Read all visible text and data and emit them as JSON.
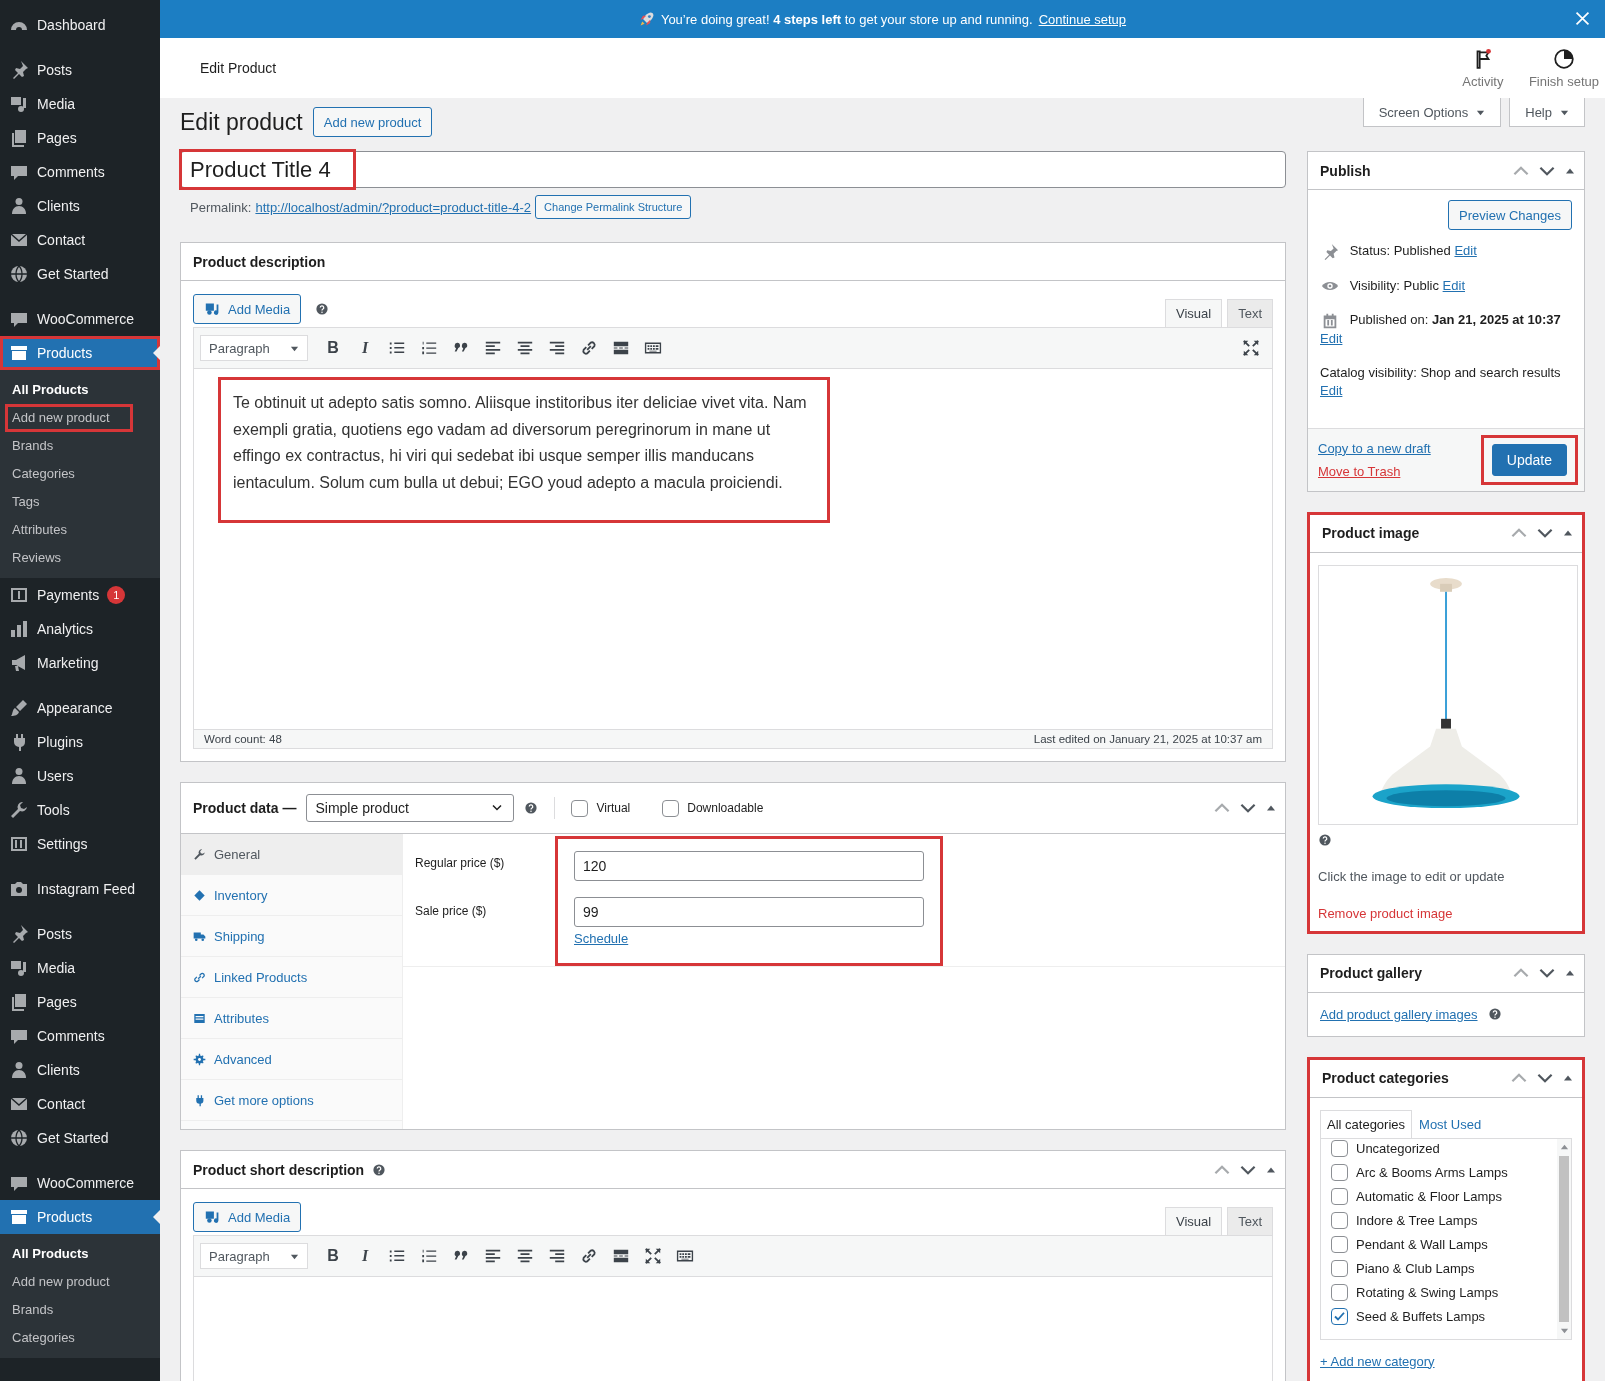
{
  "notice": {
    "text": "You’re doing great! **4 steps left** to get your store up and running.",
    "link": "Continue setup"
  },
  "sidebar": {
    "groups": [
      {
        "items": [
          {
            "label": "Dashboard",
            "selected": false,
            "highlighted": false
          }
        ]
      },
      {
        "items": [
          {
            "label": "Posts",
            "selected": false,
            "highlighted": false
          },
          {
            "label": "Media",
            "selected": false,
            "highlighted": false
          },
          {
            "label": "Pages",
            "selected": false,
            "highlighted": false
          },
          {
            "label": "Comments",
            "selected": false,
            "highlighted": false
          },
          {
            "label": "Clients",
            "selected": false,
            "highlighted": false
          },
          {
            "label": "Contact",
            "selected": false,
            "highlighted": false
          },
          {
            "label": "Get Started",
            "selected": false,
            "highlighted": false
          }
        ]
      },
      {
        "items": [
          {
            "label": "WooCommerce",
            "selected": false,
            "highlighted": false
          },
          {
            "label": "Products",
            "selected": true,
            "highlighted": true,
            "children": [
              {
                "label": "All Products",
                "selected": true,
                "highlighted": false
              },
              {
                "label": "Add new product",
                "selected": false,
                "highlighted": true
              },
              {
                "label": "Brands",
                "selected": false,
                "highlighted": false
              },
              {
                "label": "Categories",
                "selected": false,
                "highlighted": false
              },
              {
                "label": "Tags",
                "selected": false,
                "highlighted": false
              },
              {
                "label": "Attributes",
                "selected": false,
                "highlighted": false
              },
              {
                "label": "Reviews",
                "selected": false,
                "highlighted": false
              }
            ]
          },
          {
            "label": "Payments",
            "selected": false,
            "highlighted": false,
            "badge": "1"
          },
          {
            "label": "Analytics",
            "selected": false,
            "highlighted": false
          },
          {
            "label": "Marketing",
            "selected": false,
            "highlighted": false
          }
        ]
      },
      {
        "items": [
          {
            "label": "Appearance",
            "selected": false,
            "highlighted": false
          },
          {
            "label": "Plugins",
            "selected": false,
            "highlighted": false
          },
          {
            "label": "Users",
            "selected": false,
            "highlighted": false
          },
          {
            "label": "Tools",
            "selected": false,
            "highlighted": false
          },
          {
            "label": "Settings",
            "selected": false,
            "highlighted": false
          }
        ]
      },
      {
        "items": [
          {
            "label": "Instagram Feed",
            "selected": false,
            "highlighted": false
          }
        ]
      },
      {
        "items": [
          {
            "label": "Posts",
            "selected": false,
            "highlighted": false
          },
          {
            "label": "Media",
            "selected": false,
            "highlighted": false
          },
          {
            "label": "Pages",
            "selected": false,
            "highlighted": false
          },
          {
            "label": "Comments",
            "selected": false,
            "highlighted": false
          },
          {
            "label": "Clients",
            "selected": false,
            "highlighted": false
          },
          {
            "label": "Contact",
            "selected": false,
            "highlighted": false
          },
          {
            "label": "Get Started",
            "selected": false,
            "highlighted": false
          }
        ]
      },
      {
        "items": [
          {
            "label": "WooCommerce",
            "selected": false,
            "highlighted": false
          },
          {
            "label": "Products",
            "selected": true,
            "highlighted": false,
            "children": [
              {
                "label": "All Products",
                "selected": true,
                "highlighted": false
              },
              {
                "label": "Add new product",
                "selected": false,
                "highlighted": false
              },
              {
                "label": "Brands",
                "selected": false,
                "highlighted": false
              },
              {
                "label": "Categories",
                "selected": false,
                "highlighted": false
              }
            ]
          }
        ]
      }
    ]
  },
  "header": {
    "title": "Edit Product",
    "actions": [
      "Activity",
      "Finish setup"
    ]
  },
  "screen_tabs": [
    "Screen Options",
    "Help"
  ],
  "page": {
    "title": "Edit product",
    "add_button": "Add new product"
  },
  "title_field": {
    "value": "Product Title 4",
    "highlighted": true
  },
  "permalink": {
    "label": "Permalink:",
    "url": "http://localhost/admin/?product=product-title-4-2",
    "button": "Change Permalink Structure"
  },
  "description": {
    "title": "Product description",
    "add_media": "Add Media",
    "tabs": [
      {
        "label": "Visual",
        "selected": true
      },
      {
        "label": "Text",
        "selected": false
      }
    ],
    "format": "Paragraph",
    "buttons": [
      "B",
      "I"
    ],
    "text": "Te obtinuit ut adepto satis somno. Aliisque institoribus iter deliciae vivet vita. Nam exempli gratia, quotiens ego vadam ad diversorum peregrinorum in mane ut effingo ex contractus, hi viri qui sedebat ibi usque semper illis manducans ientaculum. Solum cum bulla ut debui; EGO youd adepto a macula proiciendi.",
    "highlighted": true,
    "word_count": "Word count: 48",
    "last_edited": "Last edited on January 21, 2025 at 10:37 am"
  },
  "product_data": {
    "title": "Product data —",
    "type": "Simple product",
    "options": [
      {
        "label": "Virtual",
        "checked": false
      },
      {
        "label": "Downloadable",
        "checked": false
      }
    ],
    "tabs": [
      {
        "label": "General",
        "selected": true
      },
      {
        "label": "Inventory",
        "selected": false
      },
      {
        "label": "Shipping",
        "selected": false
      },
      {
        "label": "Linked Products",
        "selected": false
      },
      {
        "label": "Attributes",
        "selected": false
      },
      {
        "label": "Advanced",
        "selected": false
      },
      {
        "label": "Get more options",
        "selected": false
      }
    ],
    "fields": [
      {
        "label": "Regular price ($)",
        "value": "120"
      },
      {
        "label": "Sale price ($)",
        "value": "99"
      }
    ],
    "schedule": "Schedule",
    "highlighted": true
  },
  "short_description": {
    "title": "Product short description",
    "add_media": "Add Media",
    "tabs": [
      {
        "label": "Visual",
        "selected": true
      },
      {
        "label": "Text",
        "selected": false
      }
    ],
    "format": "Paragraph",
    "buttons": [
      "B",
      "I"
    ]
  },
  "publish": {
    "title": "Publish",
    "preview": "Preview Changes",
    "rows": [
      {
        "text": "Status: Published",
        "edit": "Edit"
      },
      {
        "text": "Visibility: Public",
        "edit": "Edit"
      },
      {
        "text": "Published on: **Jan 21, 2025 at 10:37**",
        "edit": "Edit"
      },
      {
        "text": "Catalog visibility: Shop and search results",
        "edit": "Edit"
      }
    ],
    "copy": "Copy to a new draft",
    "trash": "Move to Trash",
    "update": "Update",
    "update_highlighted": true
  },
  "product_image": {
    "title": "Product image",
    "highlighted": true,
    "hint": "Click the image to edit or update",
    "remove": "Remove product image"
  },
  "gallery": {
    "title": "Product gallery",
    "link": "Add product gallery images"
  },
  "categories": {
    "title": "Product categories",
    "highlighted": true,
    "tabs": [
      {
        "label": "All categories",
        "selected": true
      },
      {
        "label": "Most Used",
        "selected": false
      }
    ],
    "items": [
      {
        "label": "Uncategorized",
        "checked": false
      },
      {
        "label": "Arc & Booms Arms Lamps",
        "checked": false
      },
      {
        "label": "Automatic & Floor Lamps",
        "checked": false
      },
      {
        "label": "Indore & Tree Lamps",
        "checked": false
      },
      {
        "label": "Pendant & Wall Lamps",
        "checked": false
      },
      {
        "label": "Piano & Club Lamps",
        "checked": false
      },
      {
        "label": "Rotating & Swing Lamps",
        "checked": false
      },
      {
        "label": "Seed & Buffets Lamps",
        "checked": true
      }
    ],
    "add": "+ Add new category"
  }
}
